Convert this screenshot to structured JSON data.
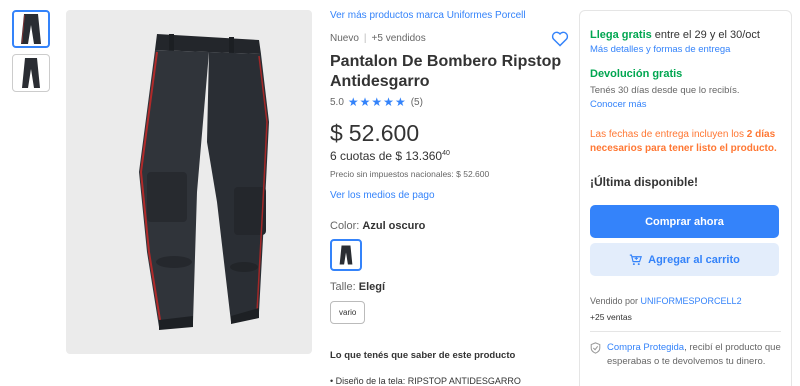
{
  "thumbnails": [
    {
      "icon": "pants-thumbnail-1",
      "selected": true
    },
    {
      "icon": "pants-thumbnail-2",
      "selected": false
    }
  ],
  "product": {
    "brand_link": "Ver más productos marca Uniformes Porcell",
    "condition": "Nuevo",
    "sold": "+5 vendidos",
    "title": "Pantalon De Bombero Ripstop Antidesgarro",
    "rating_value": "5.0",
    "rating_stars": "★★★★★",
    "rating_count": "(5)",
    "currency": "$",
    "price": "52.600",
    "installments_text": "6 cuotas de $ 13.360",
    "installments_cents": "40",
    "no_tax": "Precio sin impuestos nacionales: $ 52.600",
    "payment_link": "Ver los medios de pago",
    "color_label": "Color: ",
    "color_value": "Azul oscuro",
    "size_label": "Talle: ",
    "size_value": "Elegí",
    "size_option": "vario",
    "know_title": "Lo que tenés que saber de este producto",
    "bullet_1": "• Diseño de la tela: RIPSTOP ANTIDESGARRO"
  },
  "buybox": {
    "ship_strong": "Llega gratis",
    "ship_rest": " entre el 29 y el 30/oct",
    "ship_link": "Más detalles y formas de entrega",
    "return_title": "Devolución gratis",
    "return_desc": "Tenés 30 días desde que lo recibís.",
    "return_link": "Conocer más",
    "warning_1": "Las fechas de entrega incluyen los ",
    "warning_bold": "2 días necesarios para tener listo el producto.",
    "last_unit": "¡Última disponible!",
    "buy_button": "Comprar ahora",
    "cart_button": "Agregar al carrito",
    "seller_prefix": "Vendido por ",
    "seller_name": "UNIFORMESPORCELL2",
    "sales": "+25 ventas",
    "protect_link": "Compra Protegida",
    "protect_rest": ", recibí el producto que esperabas o te devolvemos tu dinero."
  },
  "colors": {
    "accent": "#3483fa",
    "green": "#00a650",
    "warning": "#ff7733"
  }
}
